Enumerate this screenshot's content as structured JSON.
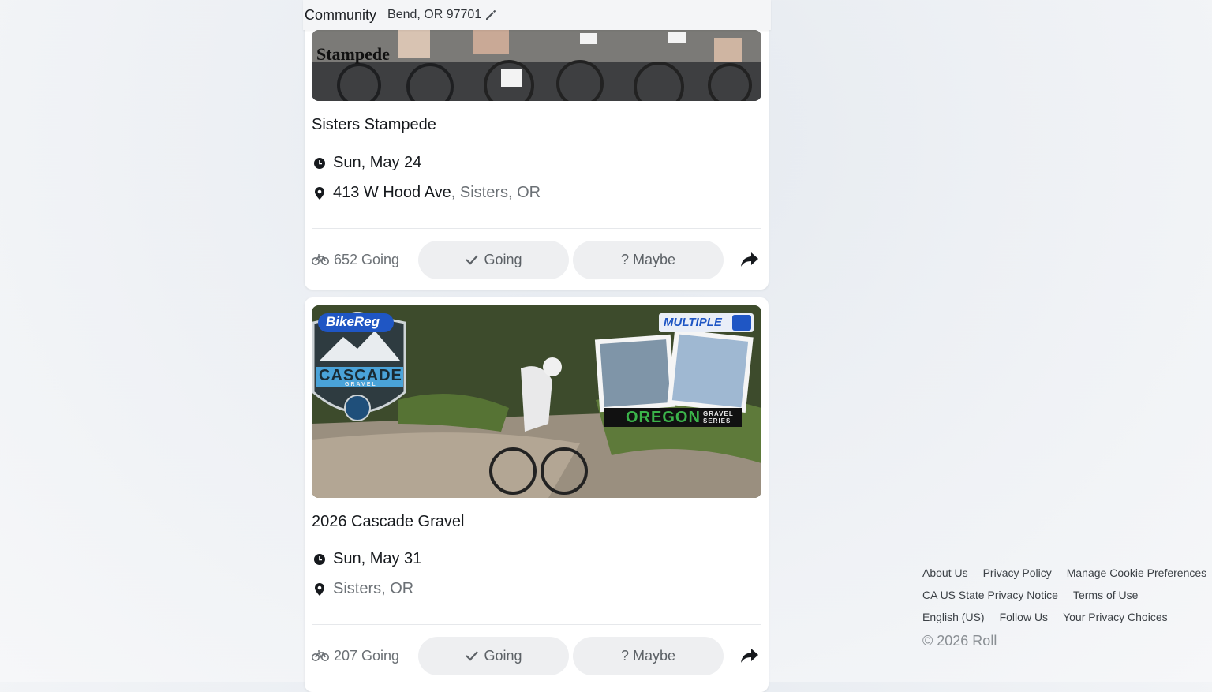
{
  "header": {
    "title": "Community",
    "location": "Bend, OR 97701",
    "edit_icon": "pencil-icon"
  },
  "events": [
    {
      "image_overlay": "Stampede",
      "title": "Sisters Stampede",
      "date": "Sun, May 24",
      "address": "413 W Hood Ave",
      "city": ", Sisters, OR",
      "going_count": "652 Going",
      "going_label": "Going",
      "maybe_label": "? Maybe"
    },
    {
      "image_brand": "BikeReg",
      "image_badge": "MULTIPLE",
      "image_logo": "CASCADE",
      "image_logo_sub": "GRAVEL",
      "image_series": "OREGON",
      "image_series_sub": "GRAVEL SERIES",
      "title": "2026 Cascade Gravel",
      "date": "Sun, May 31",
      "city": "Sisters, OR",
      "going_count": "207 Going",
      "going_label": "Going",
      "maybe_label": "? Maybe"
    }
  ],
  "footer": {
    "links_row1": [
      "About Us",
      "Privacy Policy",
      "Manage Cookie Preferences"
    ],
    "links_row2": [
      "CA US State Privacy Notice",
      "Terms of Use"
    ],
    "links_row3": [
      "English (US)",
      "Follow Us",
      "Your Privacy Choices"
    ],
    "copyright": "© 2026 Roll"
  },
  "colors": {
    "accent": "#1f56c4",
    "muted": "#6b7075",
    "pill_bg": "#eeeff1"
  }
}
